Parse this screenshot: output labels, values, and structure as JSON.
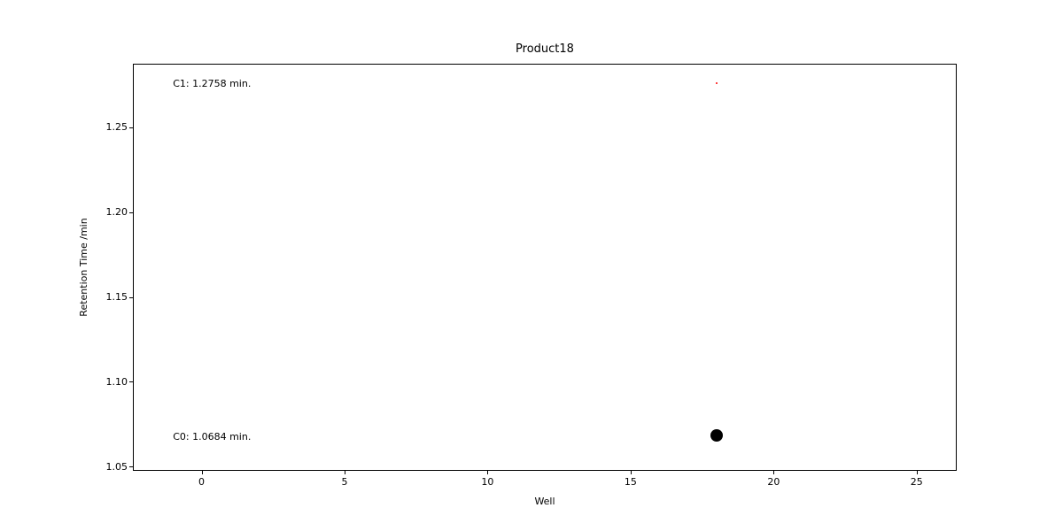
{
  "chart_data": {
    "type": "scatter",
    "title": "Product18",
    "xlabel": "Well",
    "ylabel": "Retention Time /min",
    "xlim": [
      -2.4,
      26.4
    ],
    "ylim": [
      1.0475,
      1.2875
    ],
    "xticks": [
      0,
      5,
      10,
      15,
      20,
      25
    ],
    "yticks": [
      1.05,
      1.1,
      1.15,
      1.2,
      1.25
    ],
    "ytick_labels": [
      "1.05",
      "1.10",
      "1.15",
      "1.20",
      "1.25"
    ],
    "series": [
      {
        "name": "C0",
        "x": 18,
        "y": 1.0684,
        "color": "#000000",
        "size": 14
      },
      {
        "name": "C1",
        "x": 18,
        "y": 1.2758,
        "color": "#ff0000",
        "size": 2
      }
    ],
    "annotations": [
      {
        "text": "C1: 1.2758 min.",
        "x": -1.0,
        "y": 1.2758
      },
      {
        "text": "C0: 1.0684 min.",
        "x": -1.0,
        "y": 1.068
      }
    ]
  }
}
